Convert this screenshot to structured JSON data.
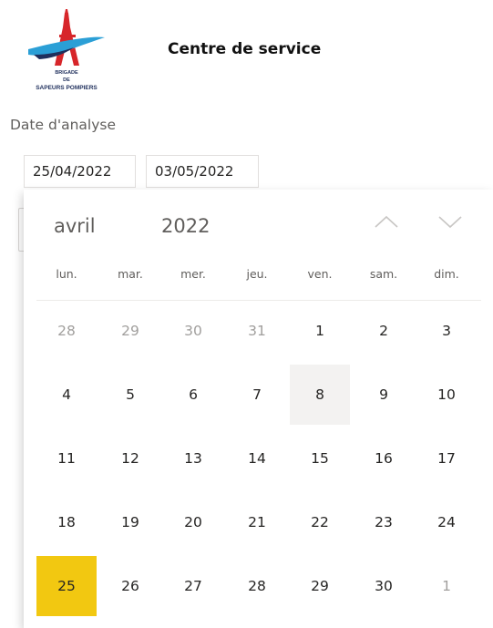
{
  "header": {
    "logo": {
      "line1": "BRIGADE",
      "line2": "DE",
      "line3": "SAPEURS POMPIERS",
      "colors": {
        "red": "#d7262a",
        "blue": "#2b9fd6",
        "navy": "#1f2f5c"
      }
    },
    "title": "Centre de service"
  },
  "filter": {
    "label": "Date d'analyse",
    "start_date": "25/04/2022",
    "end_date": "03/05/2022"
  },
  "calendar": {
    "month": "avril",
    "year": "2022",
    "weekdays": [
      "lun.",
      "mar.",
      "mer.",
      "jeu.",
      "ven.",
      "sam.",
      "dim."
    ],
    "weeks": [
      [
        {
          "d": "28",
          "muted": true
        },
        {
          "d": "29",
          "muted": true
        },
        {
          "d": "30",
          "muted": true
        },
        {
          "d": "31",
          "muted": true
        },
        {
          "d": "1"
        },
        {
          "d": "2"
        },
        {
          "d": "3"
        }
      ],
      [
        {
          "d": "4"
        },
        {
          "d": "5"
        },
        {
          "d": "6"
        },
        {
          "d": "7"
        },
        {
          "d": "8",
          "today": true
        },
        {
          "d": "9"
        },
        {
          "d": "10"
        }
      ],
      [
        {
          "d": "11"
        },
        {
          "d": "12"
        },
        {
          "d": "13"
        },
        {
          "d": "14"
        },
        {
          "d": "15"
        },
        {
          "d": "16"
        },
        {
          "d": "17"
        }
      ],
      [
        {
          "d": "18"
        },
        {
          "d": "19"
        },
        {
          "d": "20"
        },
        {
          "d": "21"
        },
        {
          "d": "22"
        },
        {
          "d": "23"
        },
        {
          "d": "24"
        }
      ],
      [
        {
          "d": "25",
          "selected": true
        },
        {
          "d": "26"
        },
        {
          "d": "27"
        },
        {
          "d": "28"
        },
        {
          "d": "29"
        },
        {
          "d": "30"
        },
        {
          "d": "1",
          "muted": true
        }
      ]
    ],
    "icons": {
      "prev": "chevron-up-icon",
      "next": "chevron-down-icon"
    },
    "colors": {
      "selected": "#f2c811",
      "today": "#f3f2f1",
      "muted_text": "#a19f9d"
    }
  }
}
